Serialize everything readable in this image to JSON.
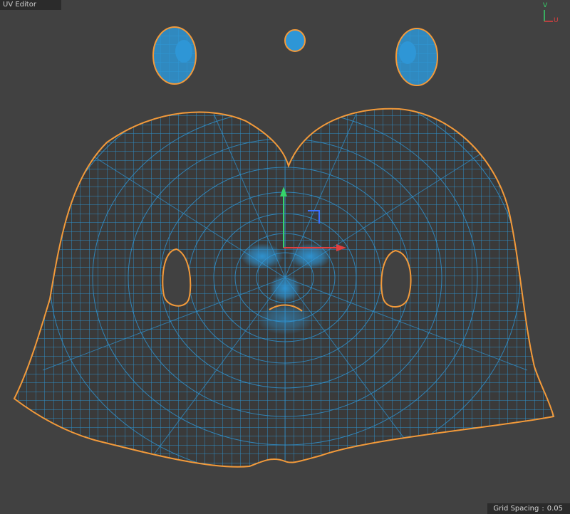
{
  "window": {
    "title": "UV Editor"
  },
  "axis_widget": {
    "v_label": "V",
    "u_label": "U"
  },
  "status": {
    "grid_spacing_label": "Grid Spacing",
    "separator": ":",
    "grid_spacing_value": "0.05"
  },
  "colors": {
    "background": "#414141",
    "title_bar": "#2b2b2b",
    "mesh_fill": "#3a3a3a",
    "mesh_wire": "#2e96d6",
    "island_border": "#f39a3a",
    "gizmo_x": "#e04040",
    "gizmo_y": "#36d36a",
    "gizmo_z": "#3a6fff"
  },
  "icons": {
    "gizmo": "transform-gizmo-icon",
    "axis": "uv-axis-icon"
  }
}
